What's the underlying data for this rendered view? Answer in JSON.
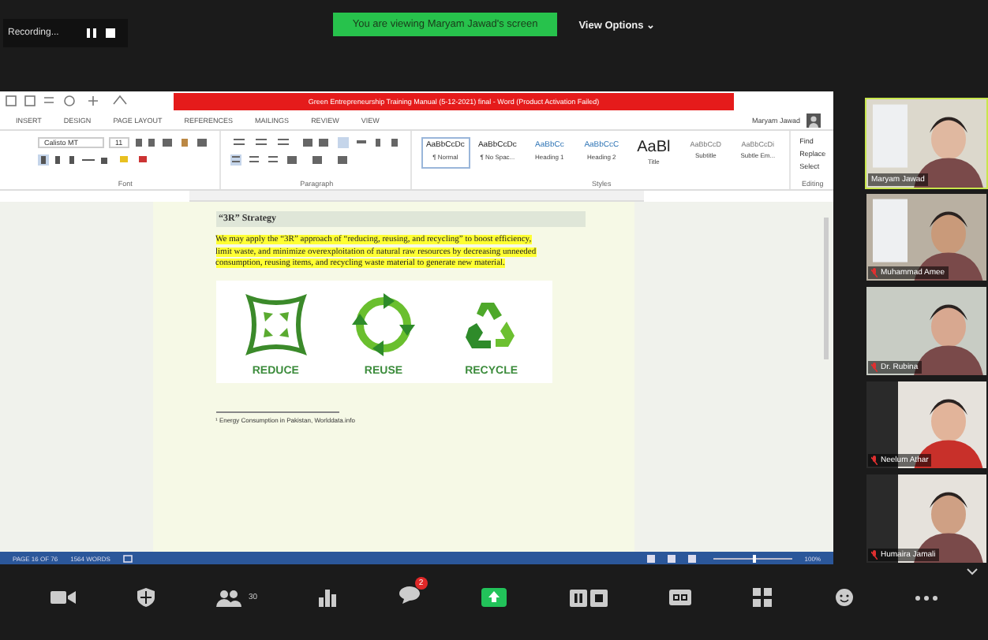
{
  "recording": {
    "label": "Recording..."
  },
  "banner": "You are viewing Maryam Jawad's screen",
  "view_options": "View Options ⌄",
  "word": {
    "title": "Green Entrepreneurship Training Manual (5-12-2021) final - Word (Product Activation Failed)",
    "tabs": [
      {
        "label": "INSERT",
        "selected": false
      },
      {
        "label": "DESIGN",
        "selected": false
      },
      {
        "label": "PAGE LAYOUT",
        "selected": false
      },
      {
        "label": "REFERENCES",
        "selected": false
      },
      {
        "label": "MAILINGS",
        "selected": false
      },
      {
        "label": "REVIEW",
        "selected": false
      },
      {
        "label": "VIEW",
        "selected": false
      }
    ],
    "user": "Maryam Jawad",
    "font": "Calisto MT",
    "size": "11",
    "styles": [
      {
        "sample": "AaBbCcDc",
        "name": "¶ Normal",
        "selected": true
      },
      {
        "sample": "AaBbCcDc",
        "name": "¶ No Spac...",
        "selected": false
      },
      {
        "sample": "AaBbCc",
        "name": "Heading 1",
        "selected": false
      },
      {
        "sample": "AaBbCcC",
        "name": "Heading 2",
        "selected": false
      },
      {
        "sample": "AaBl",
        "name": "Title",
        "selected": false
      },
      {
        "sample": "AaBbCcD",
        "name": "Subtitle",
        "selected": false
      },
      {
        "sample": "AaBbCcDi",
        "name": "Subtle Em...",
        "selected": false
      }
    ],
    "groups": [
      "Font",
      "Paragraph",
      "Styles",
      "Editing"
    ],
    "editing": [
      "Find",
      "Replace",
      "Select"
    ],
    "doc": {
      "heading": "“3R” Strategy",
      "paragraph": "We may apply the “3R” approach of “reducing, reusing, and recycling” to boost efficiency, limit waste, and minimize overexploitation of natural raw resources by decreasing unneeded consumption, reusing items, and recycling waste material to generate new material.",
      "icons": [
        {
          "kind": "reduce",
          "label": "REDUCE"
        },
        {
          "kind": "reuse",
          "label": "REUSE"
        },
        {
          "kind": "recycle",
          "label": "RECYCLE"
        }
      ],
      "footnote": "¹ Energy Consumption in Pakistan, Worlddata.info"
    },
    "status": {
      "page": "PAGE 16 OF 76",
      "words": "1564 WORDS",
      "zoom": "100%",
      "level": 0.5
    }
  },
  "participants": [
    {
      "name": "Maryam Jawad",
      "muted": false,
      "active": true
    },
    {
      "name": "Muhammad Amee",
      "muted": true,
      "active": false
    },
    {
      "name": "Dr. Rubina",
      "muted": true,
      "active": false
    },
    {
      "name": "Neelum Athar",
      "muted": true,
      "active": false
    },
    {
      "name": "Humaira Jamali",
      "muted": true,
      "active": false
    }
  ],
  "toolbar": [
    {
      "kind": "video"
    },
    {
      "kind": "security"
    },
    {
      "kind": "participants",
      "count": "30"
    },
    {
      "kind": "polls"
    },
    {
      "kind": "chat",
      "badge": "2"
    },
    {
      "kind": "share"
    },
    {
      "kind": "record"
    },
    {
      "kind": "cc"
    },
    {
      "kind": "breakout"
    },
    {
      "kind": "reactions"
    },
    {
      "kind": "more"
    }
  ]
}
